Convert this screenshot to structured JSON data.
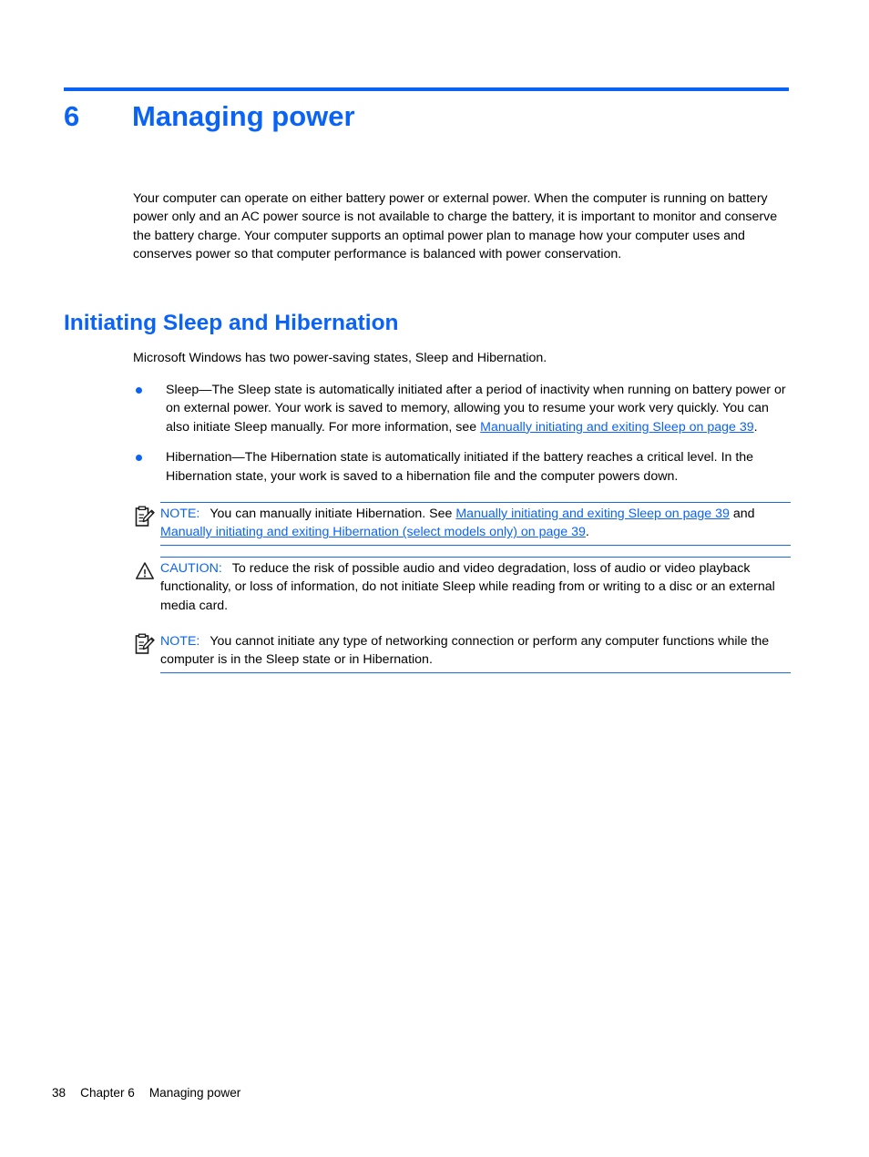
{
  "theme": {
    "accent_blue": "#0B63F6",
    "rule_blue": "#1B6BE0",
    "text_black": "#000000"
  },
  "chapter": {
    "number": "6",
    "title": "Managing power"
  },
  "intro_paragraph": "Your computer can operate on either battery power or external power. When the computer is running on battery power only and an AC power source is not available to charge the battery, it is important to monitor and conserve the battery charge. Your computer supports an optimal power plan to manage how your computer uses and conserves power so that computer performance is balanced with power conservation.",
  "section": {
    "heading": "Initiating Sleep and Hibernation",
    "lead_paragraph": "Microsoft Windows has two power-saving states, Sleep and Hibernation."
  },
  "bullets": [
    {
      "text_before_link": "Sleep—The Sleep state is automatically initiated after a period of inactivity when running on battery power or on external power. Your work is saved to memory, allowing you to resume your work very quickly. You can also initiate Sleep manually. For more information, see ",
      "link": "Manually initiating and exiting Sleep on page 39",
      "text_after_link": "."
    },
    {
      "text_before_link": "Hibernation—The Hibernation state is automatically initiated if the battery reaches a critical level. In the Hibernation state, your work is saved to a hibernation file and the computer powers down.",
      "link": "",
      "text_after_link": ""
    }
  ],
  "admonitions": [
    {
      "icon": "note-clipboard-pencil-icon",
      "label": "NOTE:",
      "segments": [
        {
          "type": "text",
          "value": "You can manually initiate Hibernation. See "
        },
        {
          "type": "link",
          "value": "Manually initiating and exiting Sleep on page 39"
        },
        {
          "type": "text",
          "value": " and "
        },
        {
          "type": "link",
          "value": "Manually initiating and exiting Hibernation (select models only) on page 39"
        },
        {
          "type": "text",
          "value": "."
        }
      ]
    },
    {
      "icon": "caution-warning-triangle-icon",
      "label": "CAUTION:",
      "segments": [
        {
          "type": "text",
          "value": "To reduce the risk of possible audio and video degradation, loss of audio or video playback functionality, or loss of information, do not initiate Sleep while reading from or writing to a disc or an external media card."
        }
      ]
    },
    {
      "icon": "note-clipboard-pencil-icon",
      "label": "NOTE:",
      "segments": [
        {
          "type": "text",
          "value": "You cannot initiate any type of networking connection or perform any computer functions while the computer is in the Sleep state or in Hibernation."
        }
      ]
    }
  ],
  "footer": {
    "page_number": "38",
    "chapter_label": "Chapter 6",
    "chapter_title": "Managing power"
  }
}
